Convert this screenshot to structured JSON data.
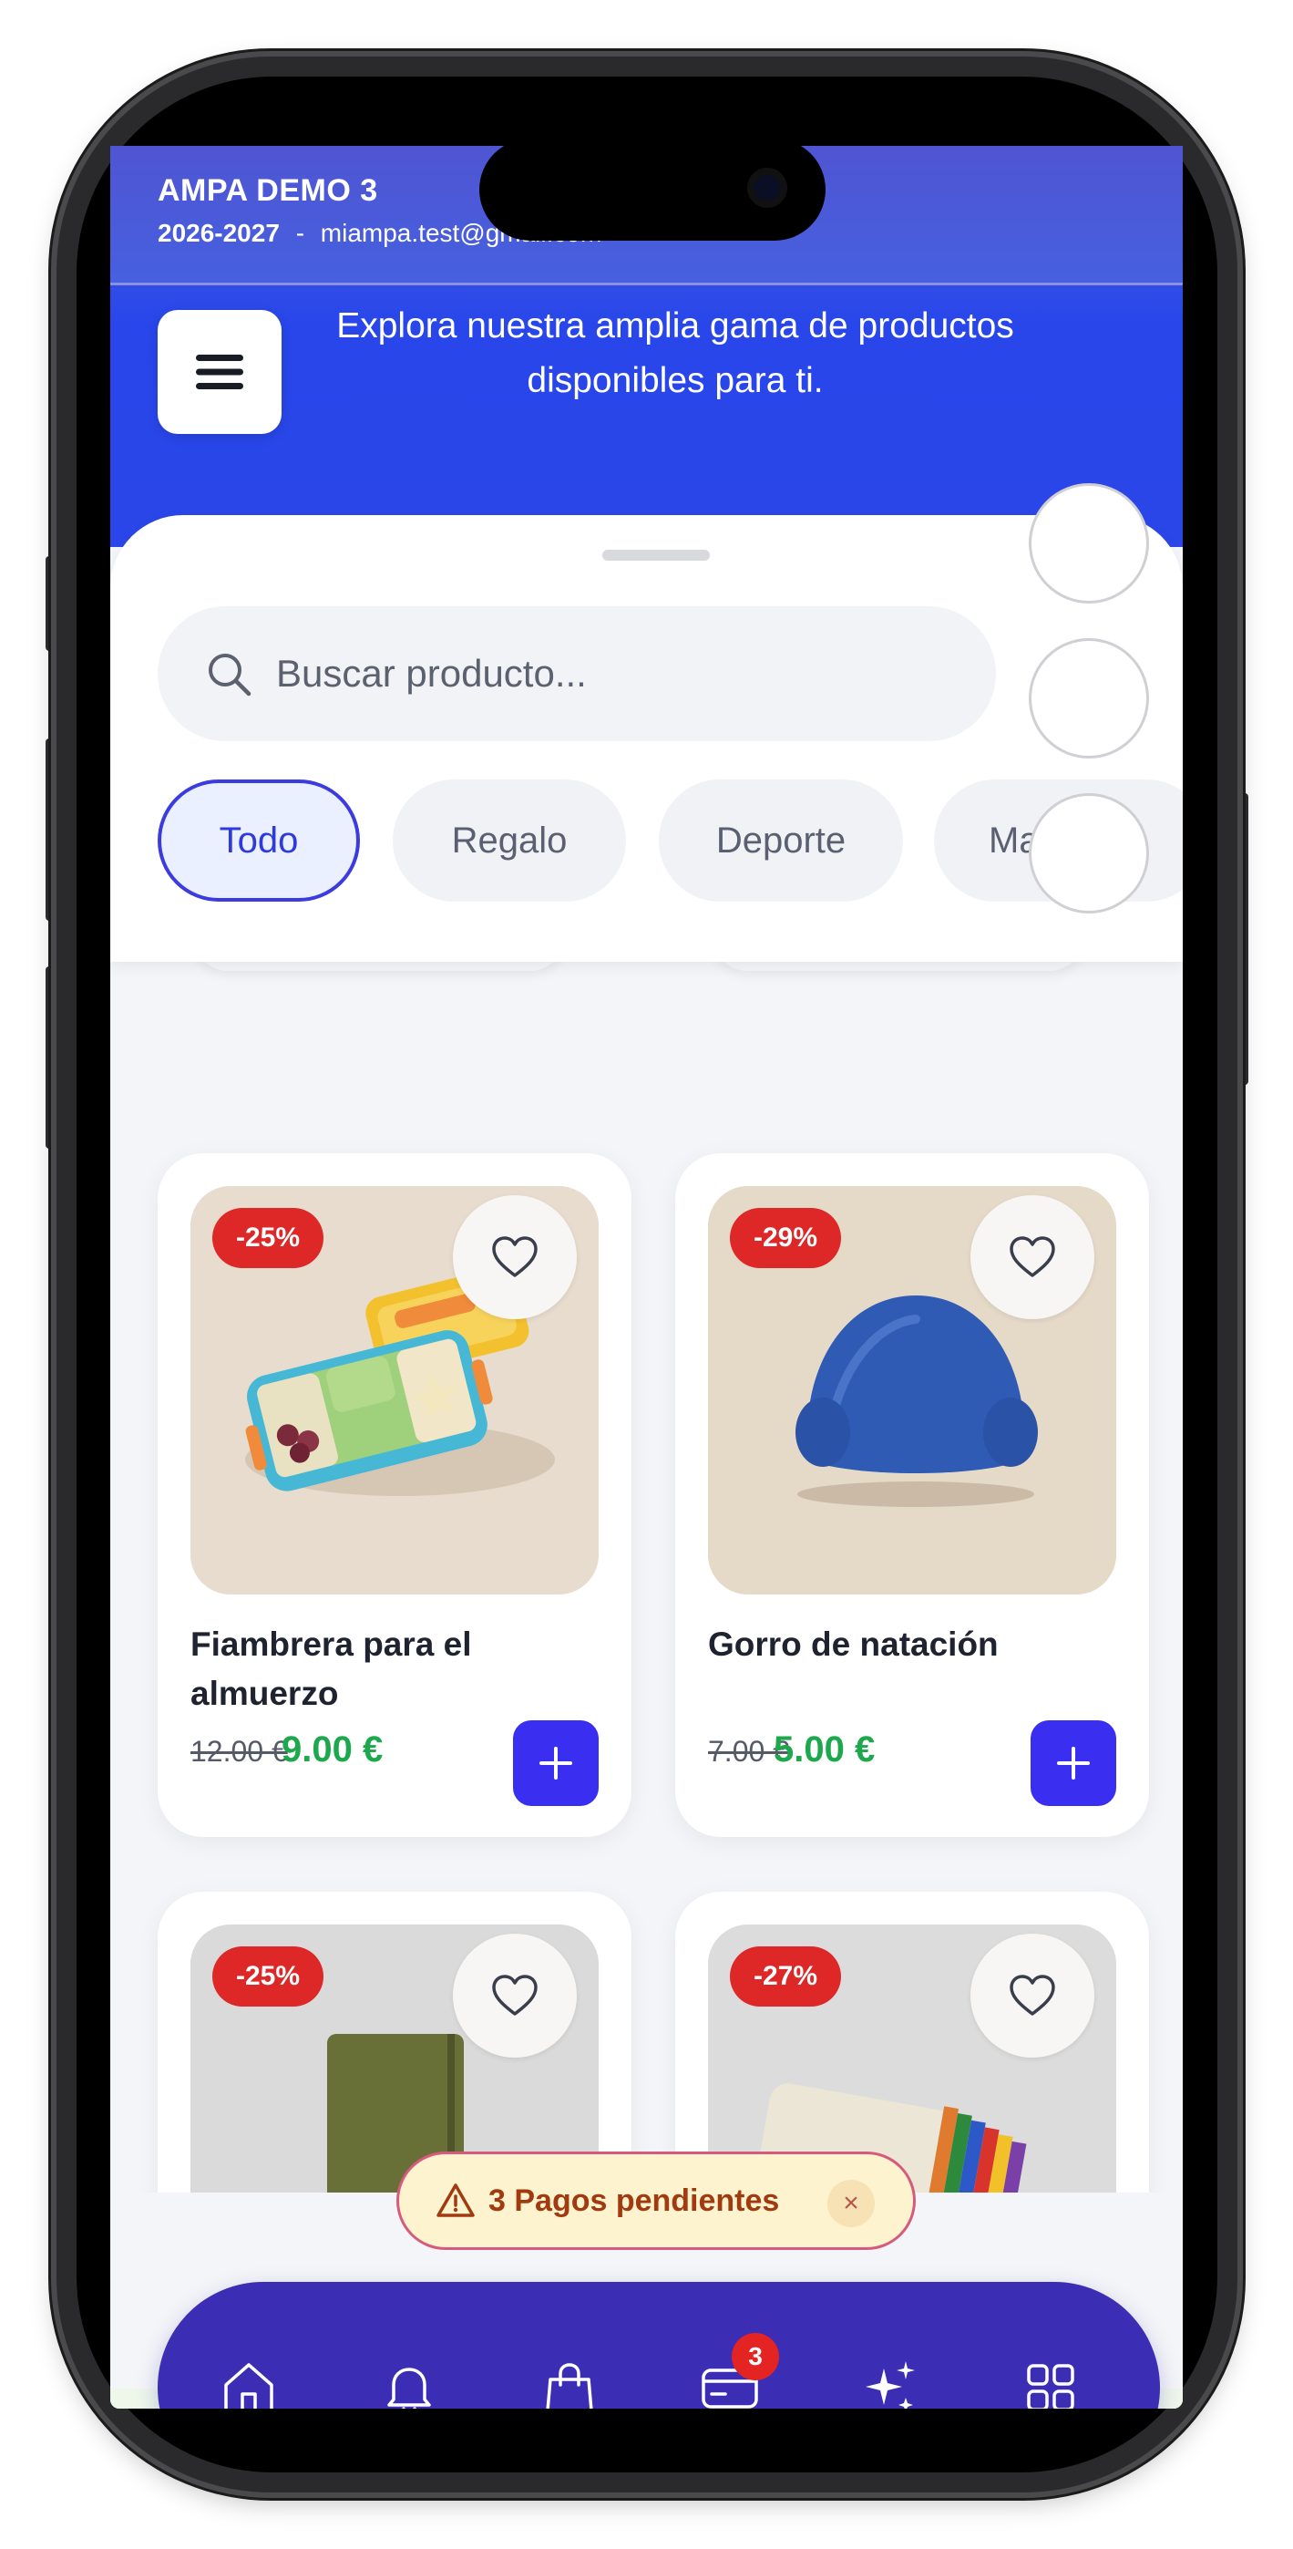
{
  "status": {
    "org_name": "AMPA DEMO 3",
    "year": "2026-2027",
    "separator": "-",
    "email": "miampa.test@gmail.com"
  },
  "header": {
    "menu_icon": "hamburger-icon",
    "subtitle": "Explora nuestra amplia gama de productos disponibles para ti."
  },
  "search": {
    "placeholder": "Buscar producto..."
  },
  "categories": [
    {
      "label": "Todo",
      "active": true
    },
    {
      "label": "Regalo",
      "active": false
    },
    {
      "label": "Deporte",
      "active": false
    },
    {
      "label": "Material",
      "active": false
    }
  ],
  "products": [
    {
      "name": "Fiambrera para el almuerzo",
      "discount": "-25%",
      "old_price": "12.00 €",
      "price": "9.00 €"
    },
    {
      "name": "Gorro de natación",
      "discount": "-29%",
      "old_price": "7.00 €",
      "price": "5.00 €"
    },
    {
      "name": "",
      "discount": "-25%",
      "old_price": "",
      "price": ""
    },
    {
      "name": "",
      "discount": "-27%",
      "old_price": "",
      "price": ""
    }
  ],
  "alert": {
    "text": "3 Pagos pendientes",
    "close": "×"
  },
  "tabbar": {
    "items": [
      {
        "icon": "home-icon"
      },
      {
        "icon": "bell-icon"
      },
      {
        "icon": "shopping-bag-icon"
      },
      {
        "icon": "card-icon",
        "badge": "3"
      },
      {
        "icon": "sparkles-icon"
      },
      {
        "icon": "grid-icon"
      }
    ]
  },
  "colors": {
    "accent": "#3a2ff0",
    "header": "#2846ea",
    "tabbar": "#3b2db4",
    "price": "#1da84d",
    "badge": "#de2727"
  }
}
